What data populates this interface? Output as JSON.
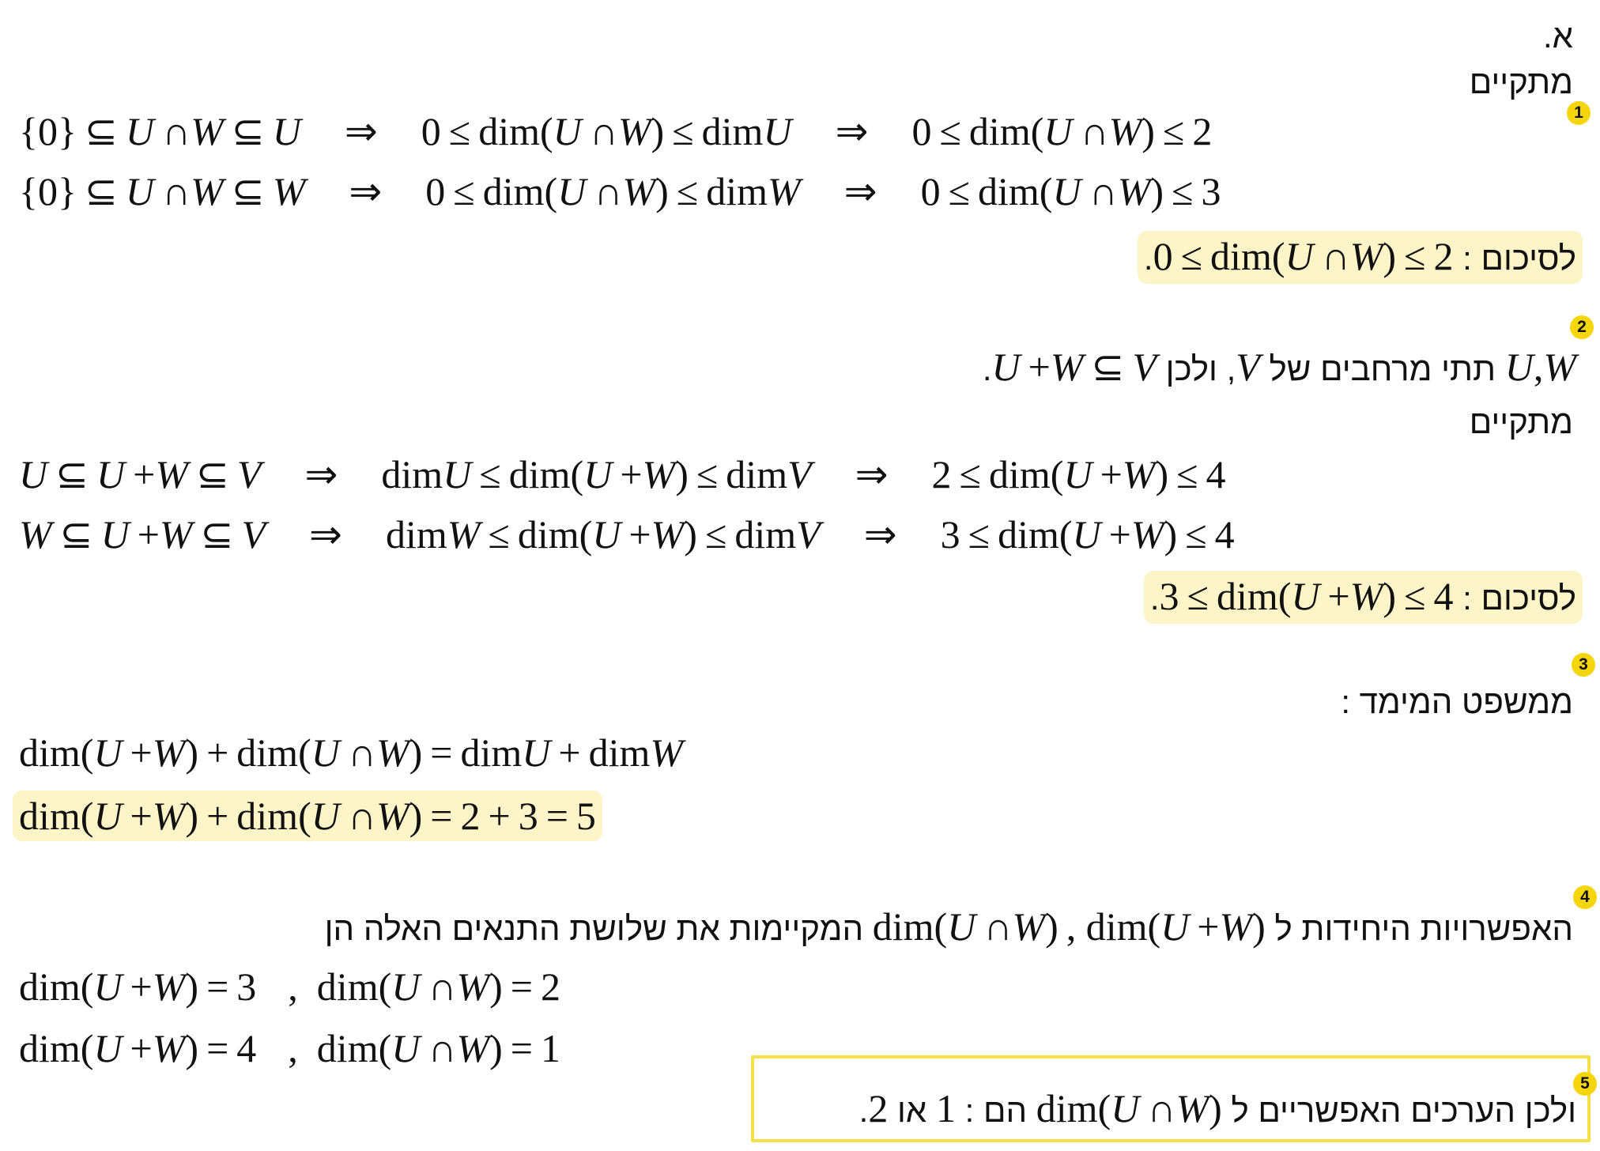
{
  "section_label": "א.",
  "holds": "מתקיים",
  "summary_prefix": "לסיכום",
  "badges": [
    "1",
    "2",
    "3",
    "4",
    "5"
  ],
  "accent_color": "#f5d50b",
  "highlight_color": "#fdf4c7",
  "box_border_color": "#f5e04a",
  "step2_text": {
    "before": "תתי מרחבים של",
    "middle": ", ולכן"
  },
  "step3_text": "ממשפט המימד",
  "step4_text": {
    "intro": "האפשרויות היחידות ל",
    "rest": "המקיימות את שלושת התנאים האלה הן"
  },
  "step5_text": {
    "intro": "ולכן הערכים האפשריים ל",
    "are": "הם",
    "or": "או"
  },
  "values": {
    "one": "1",
    "two": "2"
  }
}
